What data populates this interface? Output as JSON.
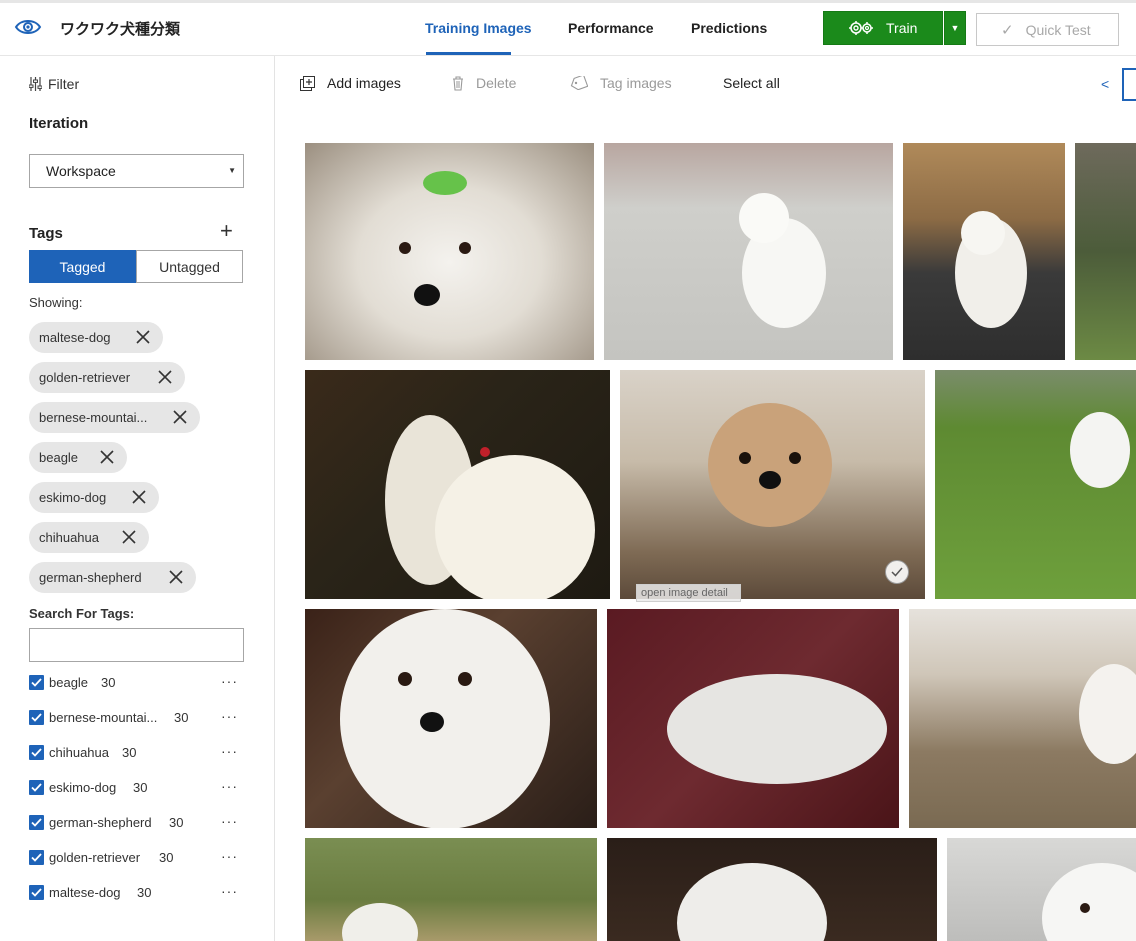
{
  "app": {
    "title": "ワクワク犬種分類"
  },
  "nav": {
    "tabs": [
      {
        "label": "Training Images"
      },
      {
        "label": "Performance"
      },
      {
        "label": "Predictions"
      }
    ]
  },
  "actions": {
    "train_label": "Train",
    "quick_test_label": "Quick Test"
  },
  "sidebar": {
    "filter_label": "Filter",
    "iteration_label": "Iteration",
    "iteration_value": "Workspace",
    "tags_label": "Tags",
    "tagged_label": "Tagged",
    "untagged_label": "Untagged",
    "showing_label": "Showing:",
    "chips": [
      {
        "label": "maltese-dog"
      },
      {
        "label": "golden-retriever"
      },
      {
        "label": "bernese-mountai..."
      },
      {
        "label": "beagle"
      },
      {
        "label": "eskimo-dog"
      },
      {
        "label": "chihuahua"
      },
      {
        "label": "german-shepherd"
      }
    ],
    "search_label": "Search For Tags:",
    "search_value": "",
    "tag_list": [
      {
        "name": "beagle",
        "count": "30"
      },
      {
        "name": "bernese-mountai...",
        "count": "30"
      },
      {
        "name": "chihuahua",
        "count": "30"
      },
      {
        "name": "eskimo-dog",
        "count": "30"
      },
      {
        "name": "german-shepherd",
        "count": "30"
      },
      {
        "name": "golden-retriever",
        "count": "30"
      },
      {
        "name": "maltese-dog",
        "count": "30"
      }
    ],
    "more_glyph": "···"
  },
  "toolbar": {
    "add_images": "Add images",
    "delete": "Delete",
    "tag_images": "Tag images",
    "select_all": "Select all",
    "prev": "<"
  },
  "gallery": {
    "tooltip": "open image detail"
  },
  "colors": {
    "accent": "#1e63b8",
    "train_green": "#1b8a1b",
    "chip_bg": "#e6e6e6"
  }
}
